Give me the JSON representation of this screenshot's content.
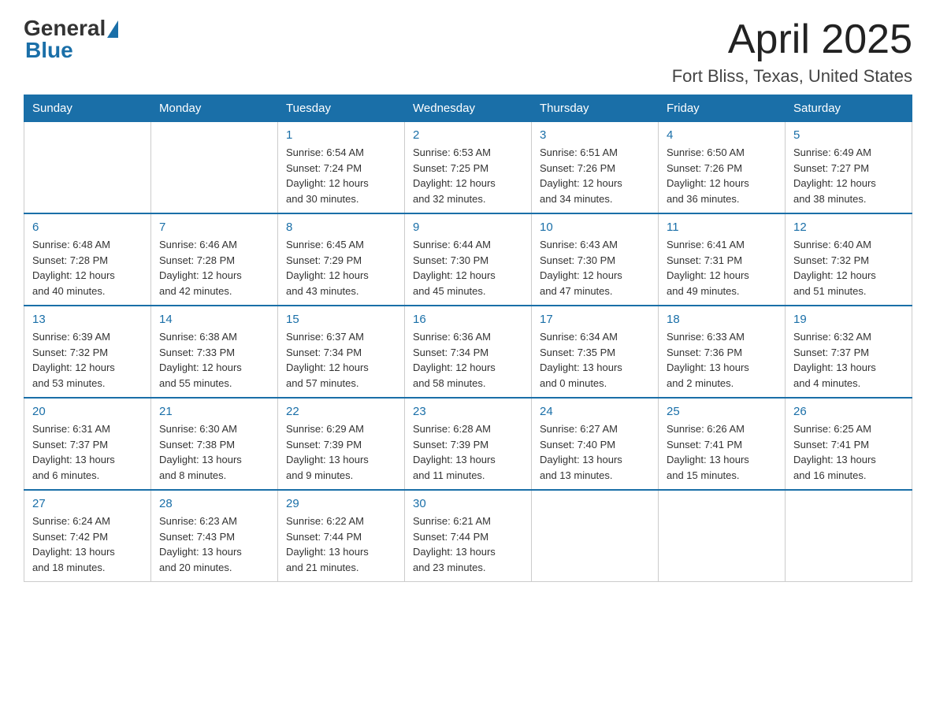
{
  "logo": {
    "general": "General",
    "blue": "Blue"
  },
  "header": {
    "month": "April 2025",
    "location": "Fort Bliss, Texas, United States"
  },
  "weekdays": [
    "Sunday",
    "Monday",
    "Tuesday",
    "Wednesday",
    "Thursday",
    "Friday",
    "Saturday"
  ],
  "weeks": [
    [
      {
        "day": "",
        "info": ""
      },
      {
        "day": "",
        "info": ""
      },
      {
        "day": "1",
        "info": "Sunrise: 6:54 AM\nSunset: 7:24 PM\nDaylight: 12 hours\nand 30 minutes."
      },
      {
        "day": "2",
        "info": "Sunrise: 6:53 AM\nSunset: 7:25 PM\nDaylight: 12 hours\nand 32 minutes."
      },
      {
        "day": "3",
        "info": "Sunrise: 6:51 AM\nSunset: 7:26 PM\nDaylight: 12 hours\nand 34 minutes."
      },
      {
        "day": "4",
        "info": "Sunrise: 6:50 AM\nSunset: 7:26 PM\nDaylight: 12 hours\nand 36 minutes."
      },
      {
        "day": "5",
        "info": "Sunrise: 6:49 AM\nSunset: 7:27 PM\nDaylight: 12 hours\nand 38 minutes."
      }
    ],
    [
      {
        "day": "6",
        "info": "Sunrise: 6:48 AM\nSunset: 7:28 PM\nDaylight: 12 hours\nand 40 minutes."
      },
      {
        "day": "7",
        "info": "Sunrise: 6:46 AM\nSunset: 7:28 PM\nDaylight: 12 hours\nand 42 minutes."
      },
      {
        "day": "8",
        "info": "Sunrise: 6:45 AM\nSunset: 7:29 PM\nDaylight: 12 hours\nand 43 minutes."
      },
      {
        "day": "9",
        "info": "Sunrise: 6:44 AM\nSunset: 7:30 PM\nDaylight: 12 hours\nand 45 minutes."
      },
      {
        "day": "10",
        "info": "Sunrise: 6:43 AM\nSunset: 7:30 PM\nDaylight: 12 hours\nand 47 minutes."
      },
      {
        "day": "11",
        "info": "Sunrise: 6:41 AM\nSunset: 7:31 PM\nDaylight: 12 hours\nand 49 minutes."
      },
      {
        "day": "12",
        "info": "Sunrise: 6:40 AM\nSunset: 7:32 PM\nDaylight: 12 hours\nand 51 minutes."
      }
    ],
    [
      {
        "day": "13",
        "info": "Sunrise: 6:39 AM\nSunset: 7:32 PM\nDaylight: 12 hours\nand 53 minutes."
      },
      {
        "day": "14",
        "info": "Sunrise: 6:38 AM\nSunset: 7:33 PM\nDaylight: 12 hours\nand 55 minutes."
      },
      {
        "day": "15",
        "info": "Sunrise: 6:37 AM\nSunset: 7:34 PM\nDaylight: 12 hours\nand 57 minutes."
      },
      {
        "day": "16",
        "info": "Sunrise: 6:36 AM\nSunset: 7:34 PM\nDaylight: 12 hours\nand 58 minutes."
      },
      {
        "day": "17",
        "info": "Sunrise: 6:34 AM\nSunset: 7:35 PM\nDaylight: 13 hours\nand 0 minutes."
      },
      {
        "day": "18",
        "info": "Sunrise: 6:33 AM\nSunset: 7:36 PM\nDaylight: 13 hours\nand 2 minutes."
      },
      {
        "day": "19",
        "info": "Sunrise: 6:32 AM\nSunset: 7:37 PM\nDaylight: 13 hours\nand 4 minutes."
      }
    ],
    [
      {
        "day": "20",
        "info": "Sunrise: 6:31 AM\nSunset: 7:37 PM\nDaylight: 13 hours\nand 6 minutes."
      },
      {
        "day": "21",
        "info": "Sunrise: 6:30 AM\nSunset: 7:38 PM\nDaylight: 13 hours\nand 8 minutes."
      },
      {
        "day": "22",
        "info": "Sunrise: 6:29 AM\nSunset: 7:39 PM\nDaylight: 13 hours\nand 9 minutes."
      },
      {
        "day": "23",
        "info": "Sunrise: 6:28 AM\nSunset: 7:39 PM\nDaylight: 13 hours\nand 11 minutes."
      },
      {
        "day": "24",
        "info": "Sunrise: 6:27 AM\nSunset: 7:40 PM\nDaylight: 13 hours\nand 13 minutes."
      },
      {
        "day": "25",
        "info": "Sunrise: 6:26 AM\nSunset: 7:41 PM\nDaylight: 13 hours\nand 15 minutes."
      },
      {
        "day": "26",
        "info": "Sunrise: 6:25 AM\nSunset: 7:41 PM\nDaylight: 13 hours\nand 16 minutes."
      }
    ],
    [
      {
        "day": "27",
        "info": "Sunrise: 6:24 AM\nSunset: 7:42 PM\nDaylight: 13 hours\nand 18 minutes."
      },
      {
        "day": "28",
        "info": "Sunrise: 6:23 AM\nSunset: 7:43 PM\nDaylight: 13 hours\nand 20 minutes."
      },
      {
        "day": "29",
        "info": "Sunrise: 6:22 AM\nSunset: 7:44 PM\nDaylight: 13 hours\nand 21 minutes."
      },
      {
        "day": "30",
        "info": "Sunrise: 6:21 AM\nSunset: 7:44 PM\nDaylight: 13 hours\nand 23 minutes."
      },
      {
        "day": "",
        "info": ""
      },
      {
        "day": "",
        "info": ""
      },
      {
        "day": "",
        "info": ""
      }
    ]
  ]
}
